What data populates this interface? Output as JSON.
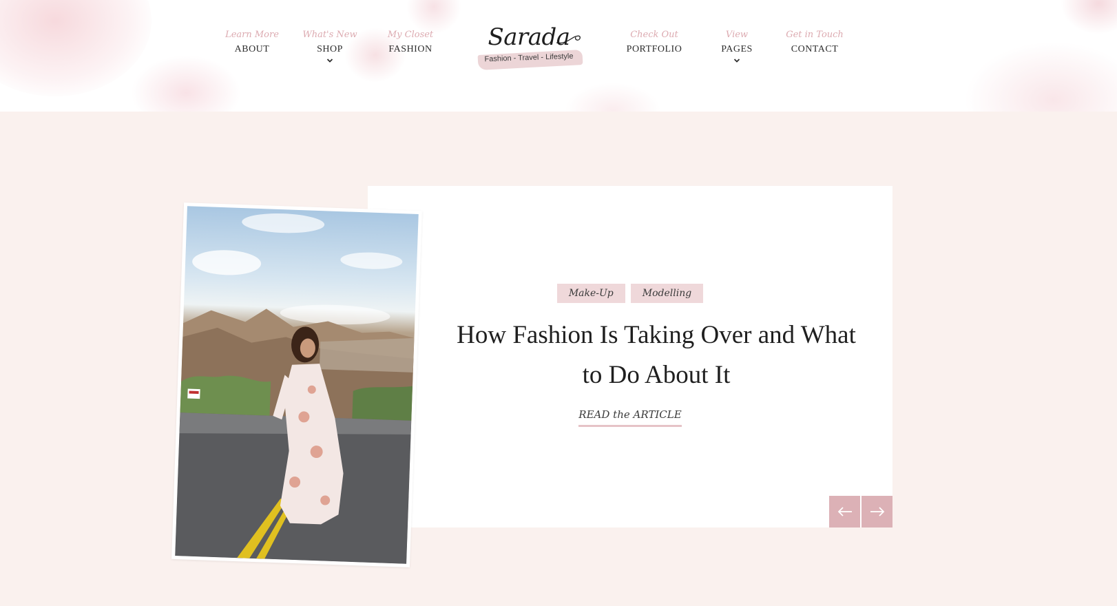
{
  "header": {
    "nav_left": [
      {
        "script": "Learn More",
        "label": "ABOUT",
        "dropdown": false
      },
      {
        "script": "What's New",
        "label": "SHOP",
        "dropdown": true
      },
      {
        "script": "My Closet",
        "label": "FASHION",
        "dropdown": false
      }
    ],
    "nav_right": [
      {
        "script": "Check Out",
        "label": "PORTFOLIO",
        "dropdown": false
      },
      {
        "script": "View",
        "label": "PAGES",
        "dropdown": true
      },
      {
        "script": "Get in Touch",
        "label": "CONTACT",
        "dropdown": false
      }
    ],
    "logo": {
      "name": "Sarada",
      "tagline": "Fashion - Travel - Lifestyle"
    }
  },
  "hero": {
    "tags": [
      "Make-Up",
      "Modelling"
    ],
    "headline": "How Fashion Is Taking Over and What to Do About It",
    "read_link": "READ the ARTICLE",
    "prev_icon": "arrow-left-icon",
    "next_icon": "arrow-right-icon"
  },
  "colors": {
    "page_background": "#faf1ee",
    "accent_pink": "#dcb1b6",
    "tag_background": "#efd8da",
    "nav_script": "#dcaab0"
  }
}
